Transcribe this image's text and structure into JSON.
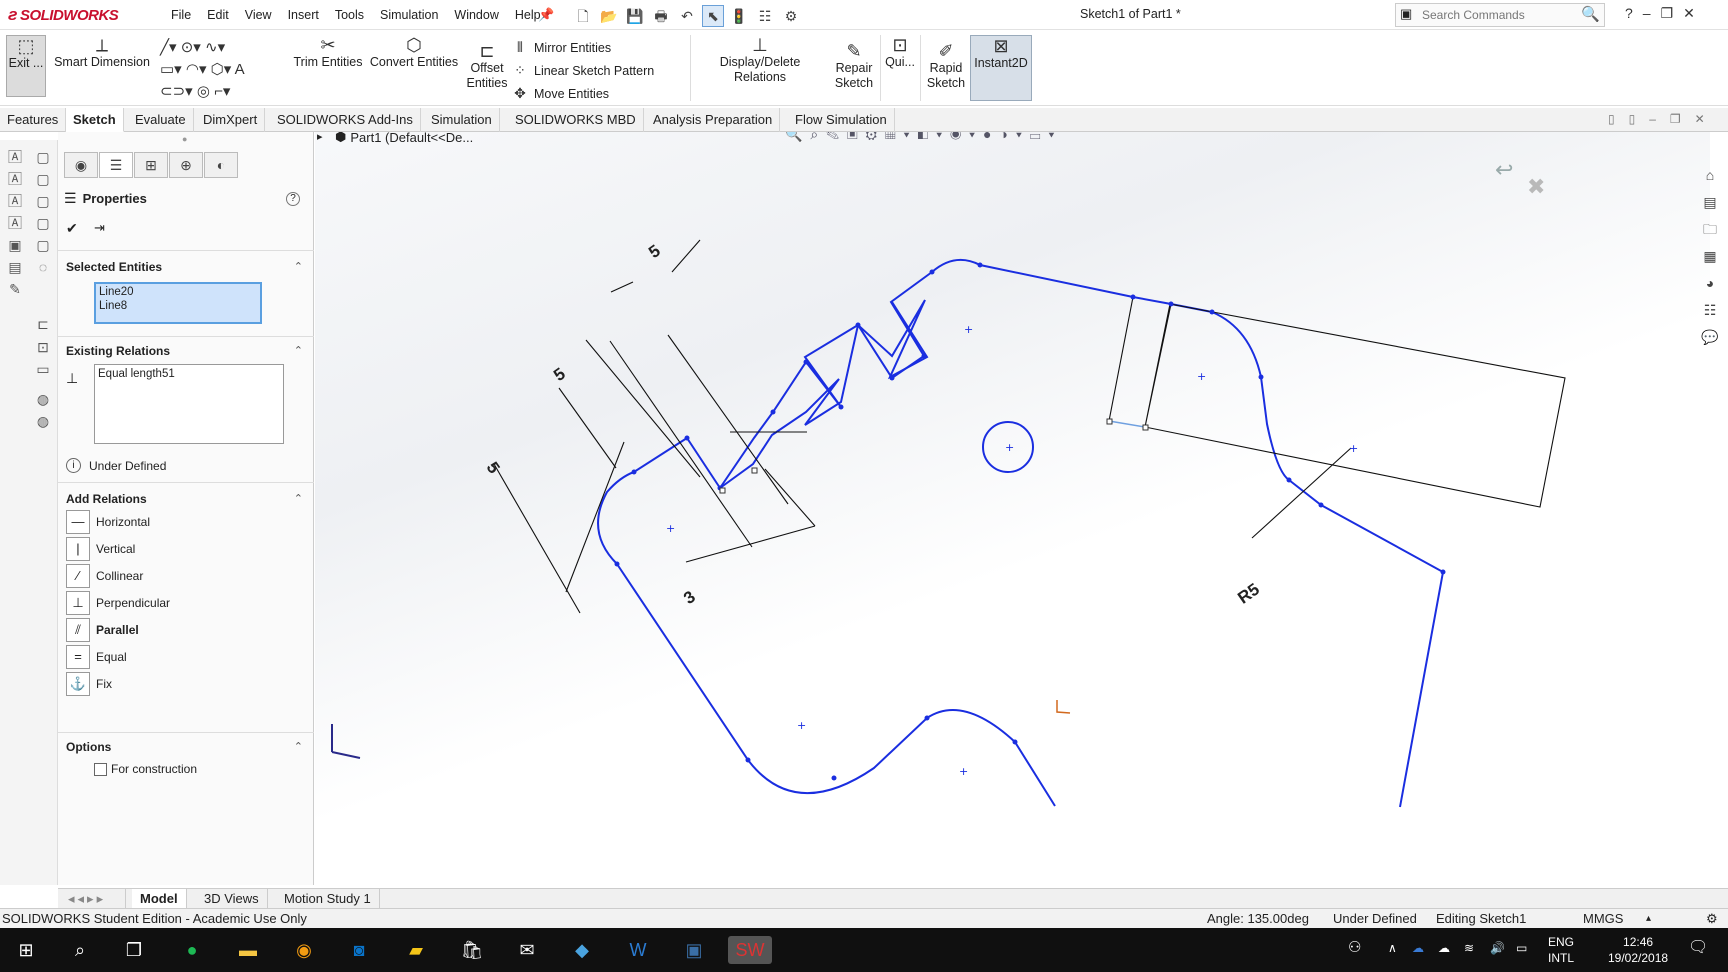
{
  "app": {
    "logo": "SOLIDWORKS",
    "window_title": "Sketch1 of Part1 *"
  },
  "menu": [
    "File",
    "Edit",
    "View",
    "Insert",
    "Tools",
    "Simulation",
    "Window",
    "Help"
  ],
  "search": {
    "placeholder": "Search Commands"
  },
  "ribbon": {
    "exit": "Exit ...",
    "smart_dimension": "Smart Dimension",
    "trim": "Trim Entities",
    "convert": "Convert Entities",
    "offset_line1": "Offset",
    "offset_line2": "Entities",
    "mirror": "Mirror Entities",
    "linear_pattern": "Linear Sketch Pattern",
    "move": "Move Entities",
    "display_relations": "Display/Delete Relations",
    "repair_line1": "Repair",
    "repair_line2": "Sketch",
    "quick": "Qui...",
    "rapid_line1": "Rapid",
    "rapid_line2": "Sketch",
    "instant2d": "Instant2D"
  },
  "tabs": [
    "Features",
    "Sketch",
    "Evaluate",
    "DimXpert",
    "SOLIDWORKS Add-Ins",
    "Simulation",
    "SOLIDWORKS MBD",
    "Analysis Preparation",
    "Flow Simulation"
  ],
  "active_tab": "Sketch",
  "tree": {
    "label": "Part1  (Default<<De..."
  },
  "properties": {
    "title": "Properties",
    "selected_entities_title": "Selected Entities",
    "selected_entities": [
      "Line20",
      "Line8"
    ],
    "existing_relations_title": "Existing Relations",
    "existing_relations": [
      "Equal length51"
    ],
    "status": "Under Defined",
    "add_relations_title": "Add Relations",
    "relations": [
      "Horizontal",
      "Vertical",
      "Collinear",
      "Perpendicular",
      "Parallel",
      "Equal",
      "Fix"
    ],
    "options_title": "Options",
    "for_construction": "For construction"
  },
  "dimensions": {
    "d1": "5",
    "d2": "5",
    "d3": "5",
    "d4": "3",
    "r": "R5"
  },
  "bottom_tabs": [
    "Model",
    "3D Views",
    "Motion Study 1"
  ],
  "status_bar": {
    "left": "SOLIDWORKS Student Edition - Academic Use Only",
    "angle": "Angle: 135.00deg",
    "defined": "Under Defined",
    "editing": "Editing Sketch1",
    "units": "MMGS"
  },
  "taskbar": {
    "lang1": "ENG",
    "lang2": "INTL",
    "time": "12:46",
    "date": "19/02/2018"
  },
  "colors": {
    "sketch_blue": "#1a2ee0",
    "selection_fill": "#cfe3fb"
  }
}
